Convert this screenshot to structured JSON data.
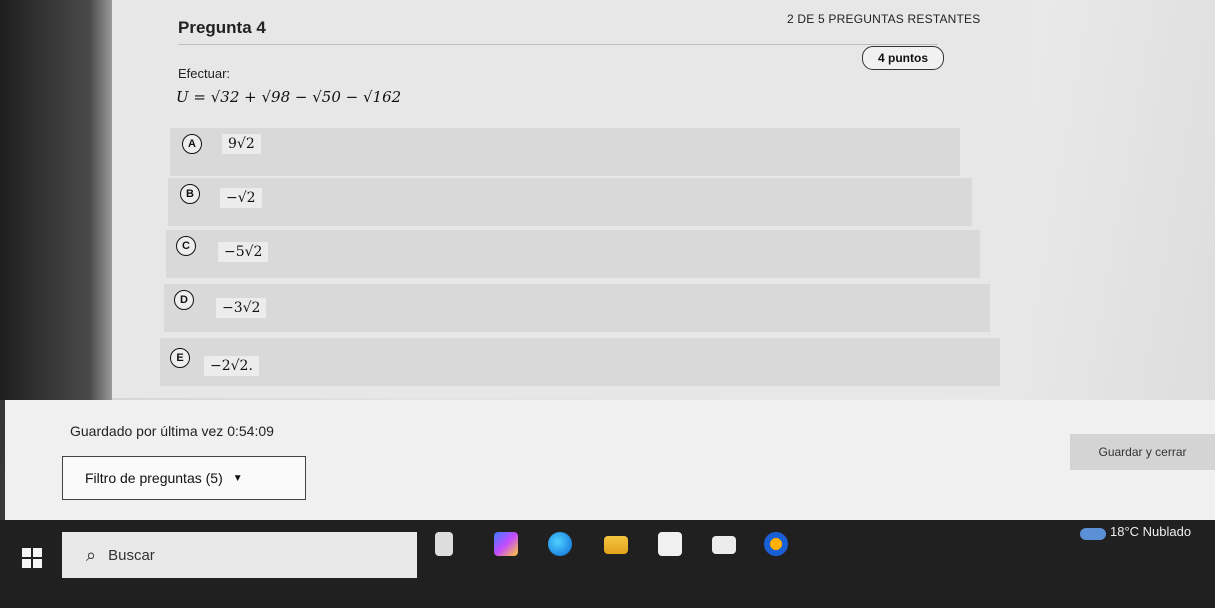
{
  "question": {
    "remaining": "2 DE 5 PREGUNTAS RESTANTES",
    "title": "Pregunta 4",
    "points": "4 puntos",
    "instruction": "Efectuar:",
    "equation": "U = √32 + √98 − √50 − √162"
  },
  "options": [
    {
      "letter": "A",
      "value": "9√2"
    },
    {
      "letter": "B",
      "value": "−√2"
    },
    {
      "letter": "C",
      "value": "−5√2"
    },
    {
      "letter": "D",
      "value": "−3√2"
    },
    {
      "letter": "E",
      "value": "−2√2."
    }
  ],
  "footer": {
    "saved_label": "Guardado por última vez 0:54:09",
    "filter_label": "Filtro de preguntas (5)",
    "save_button": "Guardar y cerrar"
  },
  "taskbar": {
    "search_label": "Buscar",
    "weather": "18°C Nublado"
  }
}
